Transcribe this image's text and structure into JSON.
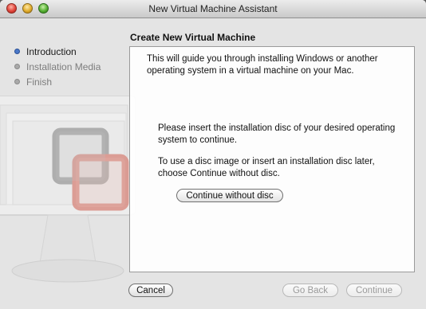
{
  "window": {
    "title": "New Virtual Machine Assistant"
  },
  "sidebar": {
    "steps": [
      {
        "label": "Introduction",
        "state": "active"
      },
      {
        "label": "Installation Media",
        "state": "inactive"
      },
      {
        "label": "Finish",
        "state": "inactive"
      }
    ]
  },
  "main": {
    "heading": "Create New Virtual Machine",
    "intro_text": "This will guide you through installing Windows or another operating system in a virtual machine on your Mac.",
    "insert_text": "Please insert the installation disc of your desired operating system to continue.",
    "later_text": "To use a disc image or insert an installation disc later, choose Continue without disc.",
    "continue_without_disc_label": "Continue without disc"
  },
  "footer": {
    "cancel_label": "Cancel",
    "go_back_label": "Go Back",
    "continue_label": "Continue"
  },
  "colors": {
    "active_step": "#4a78c8",
    "inactive_step": "#a9a9a9"
  }
}
